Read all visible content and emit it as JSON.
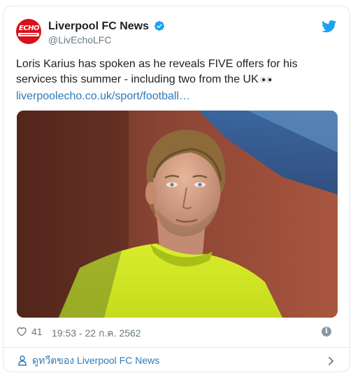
{
  "tweet": {
    "author": {
      "display_name": "Liverpool FC News",
      "handle": "@LivEchoLFC",
      "avatar_text": "ECHO",
      "verified": true
    },
    "text": "Loris Karius has spoken as he reveals FIVE offers for his services this summer - including two from the UK",
    "emoji": "eyes",
    "link": "liverpoolecho.co.uk/sport/football…",
    "likes": "41",
    "timestamp": "19:53 - 22 ก.ค. 2562"
  },
  "footer": {
    "label": "ดูทวีตของ Liverpool FC News"
  },
  "colors": {
    "link": "#2b7bb9",
    "twitter_blue": "#1da1f2",
    "muted": "#697882",
    "avatar_red": "#d7111b"
  },
  "icons": [
    "twitter-bird-icon",
    "verified-badge-icon",
    "heart-icon",
    "info-icon",
    "profile-icon",
    "chevron-right-icon"
  ]
}
